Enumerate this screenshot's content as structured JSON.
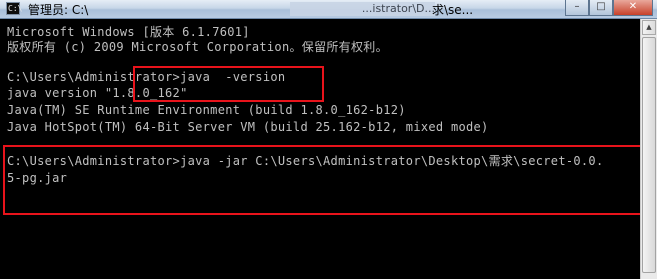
{
  "window": {
    "title": "管理员: C:\\",
    "title_obscured": "...istrator\\D...",
    "title_right": "求\\se...",
    "app_icon": "C:\\",
    "controls": {
      "minimize_icon": "minimize-icon",
      "maximize_icon": "maximize-icon",
      "close_icon": "close-icon",
      "minimize_glyph": "–",
      "maximize_glyph": "□",
      "close_glyph": "✕"
    }
  },
  "console": {
    "lines": [
      "Microsoft Windows [版本 6.1.7601]",
      "版权所有 (c) 2009 Microsoft Corporation。保留所有权利。",
      "",
      "C:\\Users\\Administrator>java  -version",
      "java version \"1.8.0_162\"",
      "Java(TM) SE Runtime Environment (build 1.8.0_162-b12)",
      "Java HotSpot(TM) 64-Bit Server VM (build 25.162-b12, mixed mode)",
      "",
      "C:\\Users\\Administrator>java -jar C:\\Users\\Administrator\\Desktop\\需求\\secret-0.0.",
      "5-pg.jar"
    ]
  },
  "annotations": {
    "color": "#e8131b"
  },
  "scrollbar": {
    "up_glyph": "▲"
  }
}
